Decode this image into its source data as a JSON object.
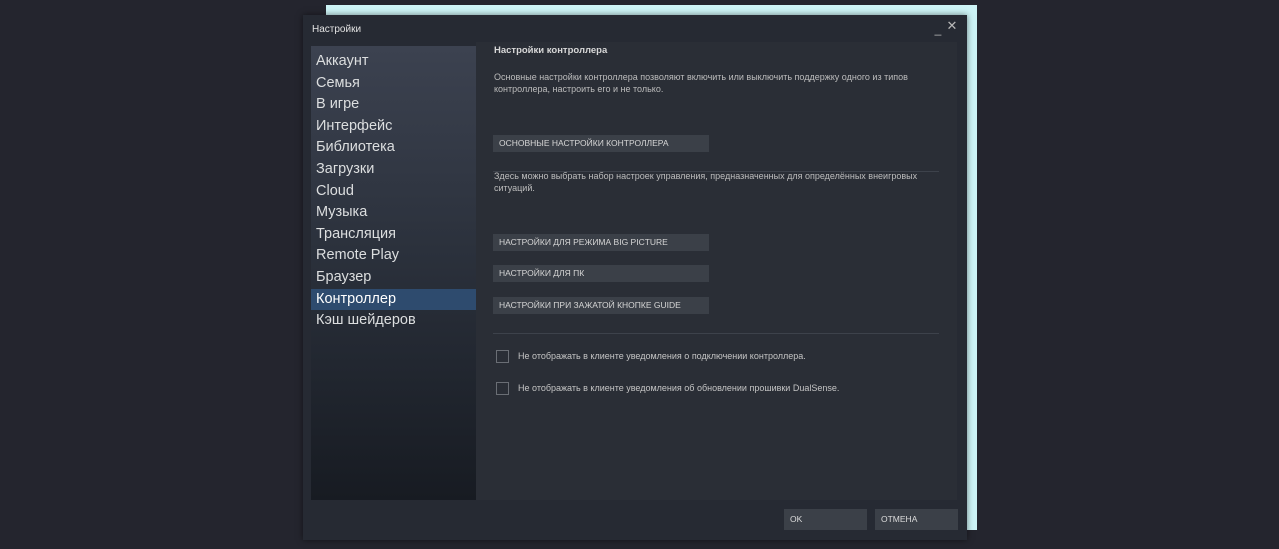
{
  "window": {
    "title": "Настройки",
    "minimize_glyph": "_",
    "close_glyph": "✕"
  },
  "sidebar": {
    "items": [
      {
        "label": "Аккаунт"
      },
      {
        "label": "Семья"
      },
      {
        "label": "В игре"
      },
      {
        "label": "Интерфейс"
      },
      {
        "label": "Библиотека"
      },
      {
        "label": "Загрузки"
      },
      {
        "label": "Cloud"
      },
      {
        "label": "Музыка"
      },
      {
        "label": "Трансляция"
      },
      {
        "label": "Remote Play"
      },
      {
        "label": "Браузер"
      },
      {
        "label": "Контроллер",
        "active": true
      },
      {
        "label": "Кэш шейдеров"
      }
    ]
  },
  "content": {
    "section_title": "Настройки контроллера",
    "description_basic": "Основные настройки контроллера позволяют включить или выключить поддержку одного из типов контроллера, настроить его и не только.",
    "button_basic": "ОСНОВНЫЕ НАСТРОЙКИ КОНТРОЛЛЕРА",
    "description_configs": "Здесь можно выбрать набор настроек управления, предназначенных для определённых внеигровых ситуаций.",
    "button_big_picture": "НАСТРОЙКИ ДЛЯ РЕЖИМА BIG PICTURE",
    "button_desktop": "НАСТРОЙКИ ДЛЯ ПК",
    "button_guide": "НАСТРОЙКИ ПРИ ЗАЖАТОЙ КНОПКЕ GUIDE",
    "checkbox_connect": {
      "label": "Не отображать в клиенте уведомления о подключении контроллера.",
      "checked": false
    },
    "checkbox_firmware": {
      "label": "Не отображать в клиенте уведомления об обновлении прошивки DualSense.",
      "checked": false
    }
  },
  "footer": {
    "ok_label": "OK",
    "cancel_label": "ОТМЕНА"
  },
  "colors": {
    "window_bg": "#262a33",
    "active_item": "#2e4b6e",
    "button_bg": "#3b4048"
  }
}
